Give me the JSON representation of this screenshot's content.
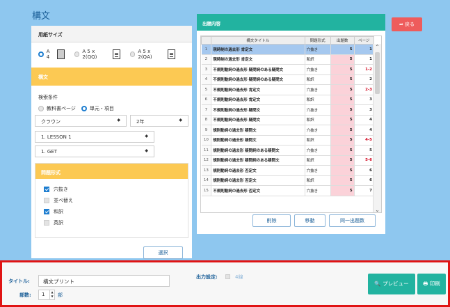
{
  "page": {
    "title": "構文"
  },
  "paper_size": {
    "heading": "用紙サイズ",
    "options": [
      {
        "label": "A 4",
        "selected": true
      },
      {
        "label": "A 5 x 2(QQ)",
        "selected": false
      },
      {
        "label": "A 5 x 2(QA)",
        "selected": false
      }
    ]
  },
  "syntax_panel": {
    "heading": "構文",
    "search_label": "検索条件",
    "search_options": [
      {
        "label": "教科書ページ",
        "selected": false
      },
      {
        "label": "単元・項目",
        "selected": true
      }
    ],
    "textbook_select": "クラウン",
    "grade_select": "2年",
    "lesson_select": "1. LESSON 1",
    "item_select": "1. GET"
  },
  "question_format": {
    "heading": "問題形式",
    "options": [
      {
        "label": "穴抜き",
        "checked": true
      },
      {
        "label": "並べ替え",
        "checked": false
      },
      {
        "label": "和訳",
        "checked": true
      },
      {
        "label": "英訳",
        "checked": false
      }
    ]
  },
  "select_button": "選択",
  "back_button": "戻る",
  "questions_panel": {
    "heading": "出題内容",
    "columns": [
      "",
      "構文タイトル",
      "問題形式",
      "出題数",
      "ページ"
    ],
    "rows": [
      {
        "no": "1",
        "title": "現時制の過去形 肯定文",
        "format": "穴抜き",
        "count": "5",
        "page": "1",
        "selected": true
      },
      {
        "no": "2",
        "title": "現時制の過去形 肯定文",
        "format": "和訳",
        "count": "5",
        "page": "1"
      },
      {
        "no": "3",
        "title": "不規則動詞の過去形 疑問詞のある疑問文",
        "format": "穴抜き",
        "count": "5",
        "page": "1-2",
        "red": true
      },
      {
        "no": "4",
        "title": "不規則動詞の過去形 疑問詞のある疑問文",
        "format": "和訳",
        "count": "5",
        "page": "2"
      },
      {
        "no": "5",
        "title": "不規則動詞の過去形 肯定文",
        "format": "穴抜き",
        "count": "5",
        "page": "2-3",
        "red": true
      },
      {
        "no": "6",
        "title": "不規則動詞の過去形 肯定文",
        "format": "和訳",
        "count": "5",
        "page": "3"
      },
      {
        "no": "7",
        "title": "不規則動詞の過去形 疑問文",
        "format": "穴抜き",
        "count": "5",
        "page": "3"
      },
      {
        "no": "8",
        "title": "不規則動詞の過去形 疑問文",
        "format": "和訳",
        "count": "5",
        "page": "4"
      },
      {
        "no": "9",
        "title": "規則動詞の過去形 疑問文",
        "format": "穴抜き",
        "count": "5",
        "page": "4"
      },
      {
        "no": "10",
        "title": "規則動詞の過去形 疑問文",
        "format": "和訳",
        "count": "5",
        "page": "4-5",
        "red": true
      },
      {
        "no": "11",
        "title": "規則動詞の過去形 疑問詞のある疑問文",
        "format": "穴抜き",
        "count": "5",
        "page": "5"
      },
      {
        "no": "12",
        "title": "規則動詞の過去形 疑問詞のある疑問文",
        "format": "和訳",
        "count": "5",
        "page": "5-6",
        "red": true
      },
      {
        "no": "13",
        "title": "規則動詞の過去形 否定文",
        "format": "穴抜き",
        "count": "5",
        "page": "6"
      },
      {
        "no": "14",
        "title": "規則動詞の過去形 否定文",
        "format": "和訳",
        "count": "5",
        "page": "6"
      },
      {
        "no": "15",
        "title": "不規則動詞の過去形 否定文",
        "format": "穴抜き",
        "count": "5",
        "page": "7"
      }
    ],
    "buttons": {
      "delete": "削除",
      "move": "移動",
      "same_count": "同一出題数"
    }
  },
  "footer": {
    "title_label": "タイトル:",
    "title_value": "構文プリント",
    "copies_label": "部数:",
    "copies_value": "1",
    "copies_unit": "部",
    "output_label": "出力設定:",
    "output_option": "4線",
    "preview_button": "プレビュー",
    "print_button": "印刷"
  },
  "colors": {
    "background": "#8ec7ef",
    "accent_teal": "#22b3a0",
    "accent_orange": "#fcc953",
    "back_red": "#ee5c5c",
    "highlight_border": "#e01414"
  }
}
